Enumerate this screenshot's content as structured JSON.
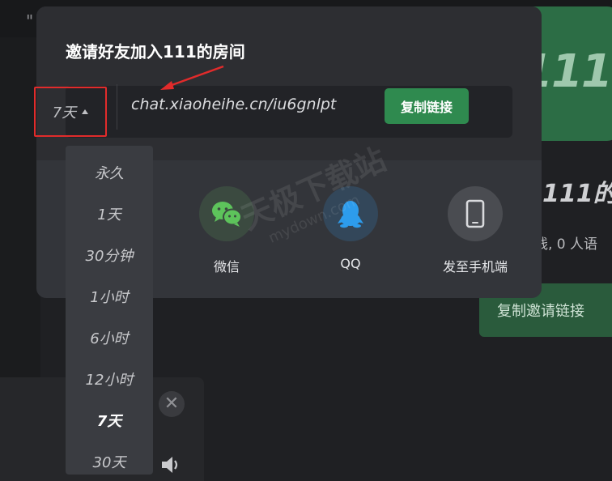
{
  "background": {
    "header_glyph": "\"",
    "card_number": "111",
    "room_title_partial": "111的",
    "room_stats_partial": "线, 0 人语",
    "copy_invite_label": "复制邀请链接",
    "close_glyph": "✕"
  },
  "modal": {
    "title": "邀请好友加入111的房间",
    "link_url": "chat.xiaoheihe.cn/iu6gnlpt",
    "copy_button_label": "复制链接",
    "duration": {
      "selected": "7天",
      "options": [
        "永久",
        "1天",
        "30分钟",
        "1小时",
        "6小时",
        "12小时",
        "7天",
        "30天"
      ]
    },
    "share": {
      "wechat_label": "微信",
      "qq_label": "QQ",
      "phone_label": "发至手机端"
    }
  },
  "watermark": {
    "line1": "天极下载站",
    "line2": "mydown.com"
  },
  "colors": {
    "modal_bg": "#33353a",
    "accent_green": "#2f8a4f",
    "highlight_red": "#e12b2b",
    "wechat_green": "#5dc35b",
    "qq_blue": "#2d9cec"
  }
}
